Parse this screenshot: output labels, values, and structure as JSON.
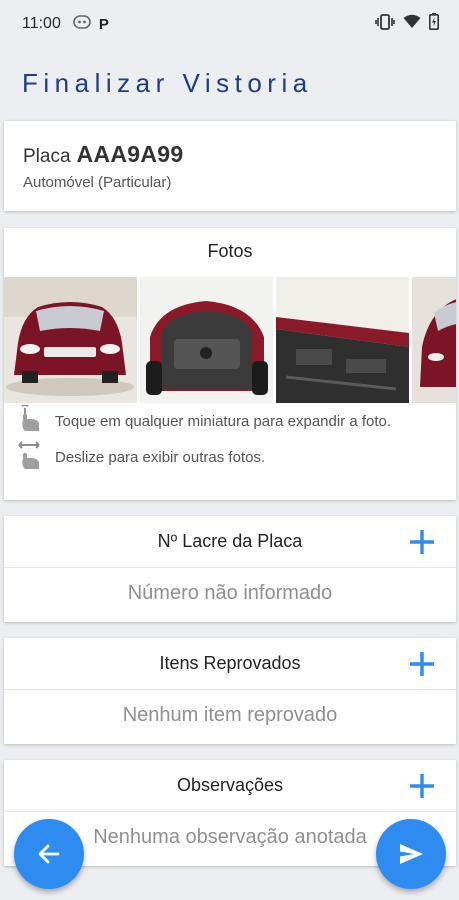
{
  "status_bar": {
    "time": "11:00",
    "left_icons": [
      "notification-icon",
      "parking-p-icon"
    ],
    "p_label": "P",
    "right_icons": [
      "vibrate-icon",
      "wifi-icon",
      "battery-icon"
    ]
  },
  "header": {
    "title": "Finalizar Vistoria"
  },
  "plate": {
    "prefix": "Placa",
    "number": "AAA9A99",
    "vehicle_type": "Automóvel (Particular)"
  },
  "photos": {
    "title": "Fotos",
    "thumbnails": [
      "car-front-photo",
      "car-underside-photo",
      "car-side-underbody-photo",
      "car-front-partial-photo"
    ],
    "hints": [
      {
        "icon": "tap-icon",
        "text": "Toque em qualquer miniatura para expandir a foto."
      },
      {
        "icon": "swipe-icon",
        "text": "Deslize para exibir outras fotos."
      }
    ]
  },
  "seal": {
    "title": "Nº Lacre da Placa",
    "empty_text": "Número não informado"
  },
  "rejected": {
    "title": "Itens Reprovados",
    "empty_text": "Nenhum item reprovado"
  },
  "notes": {
    "title": "Observações",
    "empty_text": "Nenhuma observação anotada"
  },
  "colors": {
    "accent": "#2e8cf0",
    "title": "#1e3c87",
    "background": "#eceef2"
  }
}
